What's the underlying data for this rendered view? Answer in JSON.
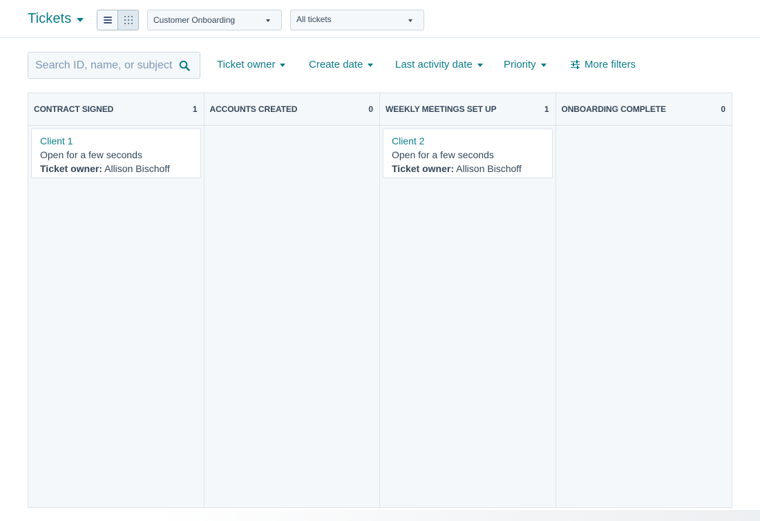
{
  "header": {
    "title": "Tickets",
    "pipeline_select": "Customer Onboarding",
    "view_select": "All tickets"
  },
  "filters": {
    "search_placeholder": "Search ID, name, or subject",
    "items": [
      {
        "label": "Ticket owner"
      },
      {
        "label": "Create date"
      },
      {
        "label": "Last activity date"
      },
      {
        "label": "Priority"
      },
      {
        "label": "More filters"
      }
    ]
  },
  "board": {
    "columns": [
      {
        "title": "CONTRACT SIGNED",
        "count": "1",
        "cards": [
          {
            "title": "Client 1",
            "status": "Open for a few seconds",
            "owner_label": "Ticket owner:",
            "owner": "Allison Bischoff"
          }
        ]
      },
      {
        "title": "ACCOUNTS CREATED",
        "count": "0",
        "cards": []
      },
      {
        "title": "WEEKLY MEETINGS SET UP",
        "count": "1",
        "cards": [
          {
            "title": "Client 2",
            "status": "Open for a few seconds",
            "owner_label": "Ticket owner:",
            "owner": "Allison Bischoff"
          }
        ]
      },
      {
        "title": "ONBOARDING COMPLETE",
        "count": "0",
        "cards": []
      }
    ]
  },
  "colors": {
    "accent": "#0b7c8a",
    "text": "#33475b",
    "border": "#dbe3ea",
    "board_bg": "#f5f8fa"
  }
}
